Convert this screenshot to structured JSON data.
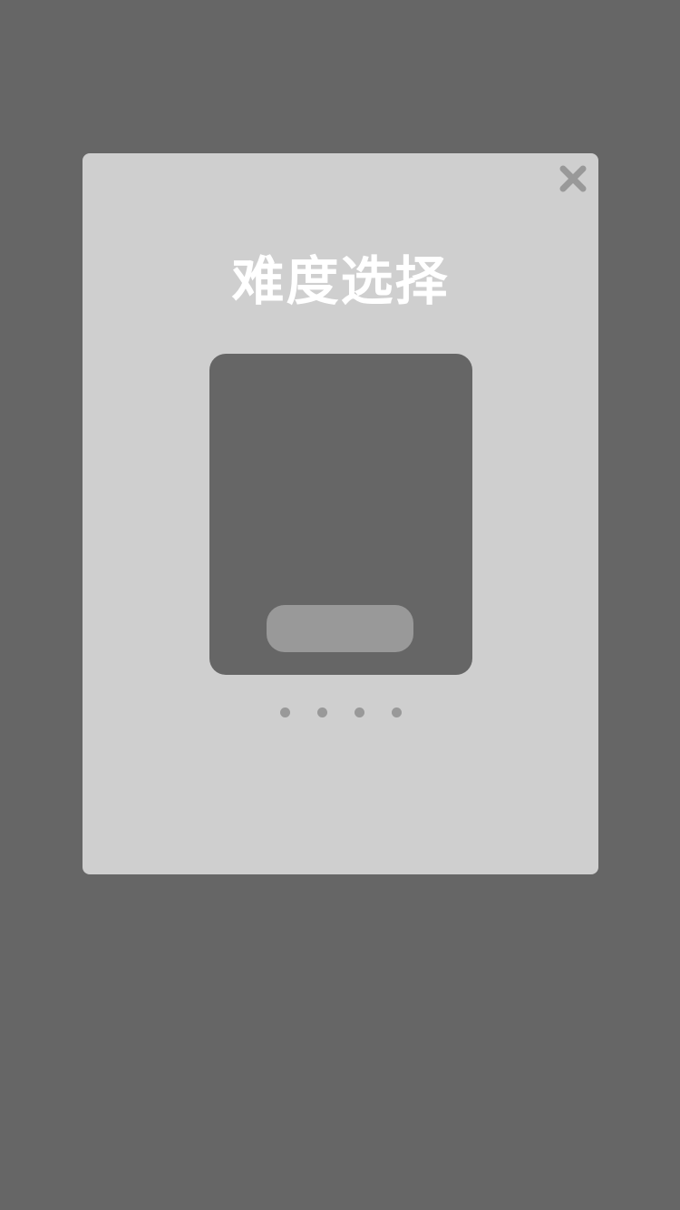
{
  "dialog": {
    "title": "难度选择",
    "close_icon": "close-icon"
  },
  "carousel": {
    "page_count": 4,
    "current_page": 1
  },
  "colors": {
    "overlay": "#666666",
    "dialog_bg": "#cfcfcf",
    "card_bg": "#666666",
    "button_bg": "#999999",
    "dot": "#999999",
    "title_text": "#ffffff"
  }
}
